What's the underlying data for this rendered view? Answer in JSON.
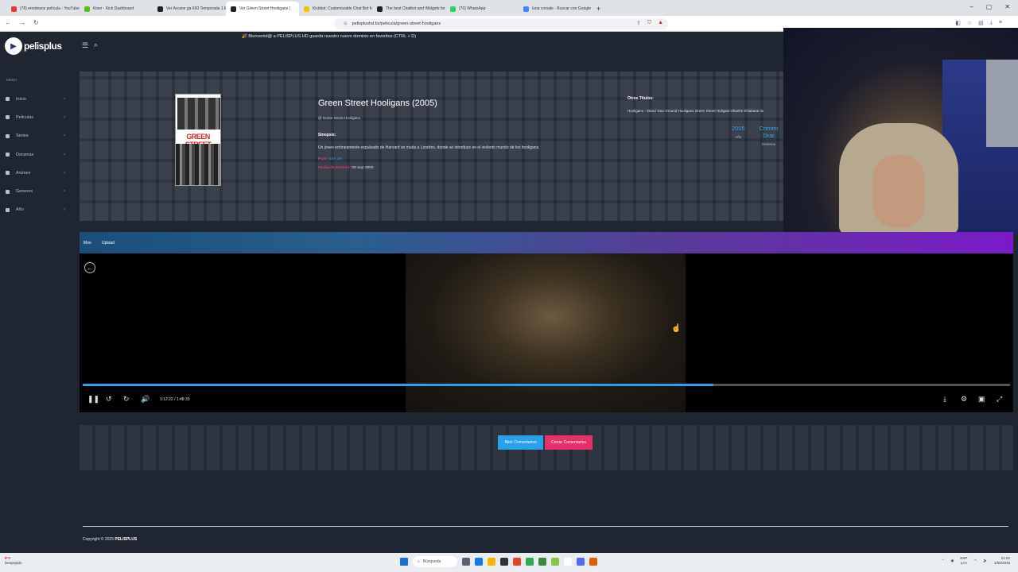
{
  "browser": {
    "tabs": [
      {
        "title": "(78) emoteans película - YouTube",
        "color": "#e53935"
      },
      {
        "title": "Kixer - Kick Dashboard",
        "color": "#53c11c"
      },
      {
        "title": "Ver Arcane ga 600 Temporada 1 Epis",
        "color": "#222"
      },
      {
        "title": "Ver Green Street Hooligans (",
        "color": "#222",
        "active": true
      },
      {
        "title": "Kickbot: Customizable Chat Bot for",
        "color": "#f2c200"
      },
      {
        "title": "The best Chatbot and Widgets for K",
        "color": "#222"
      },
      {
        "title": "(70) WhatsApp",
        "color": "#25d366"
      },
      {
        "title": "luna corsale - Buscar con Google",
        "color": "#4285f4"
      }
    ],
    "new_tab": "+",
    "window_controls": [
      "–",
      "▢",
      "✕"
    ],
    "url": "pelisplushd.bz/pelicula/green-street-hooligans"
  },
  "header": {
    "logo_text": "pelisplus",
    "banner": "🎉 Bienvenid@ a PELISPLUS HD guarda nuestro nuevo dominio en favoritos (CTRL + D)"
  },
  "sidebar": {
    "menu_label": "MENU",
    "items": [
      {
        "label": "Inicio"
      },
      {
        "label": "Peliculas"
      },
      {
        "label": "Series"
      },
      {
        "label": "Doramas"
      },
      {
        "label": "Animes"
      },
      {
        "label": "Generos"
      },
      {
        "label": "Año"
      }
    ]
  },
  "movie": {
    "poster_title": "GREEN STREET",
    "title": "Green Street Hooligans (2005)",
    "original_title": "@ Green Street Hooligans",
    "synopsis_label": "Sinopsis:",
    "synopsis": "Un joven erróneamente expulsado de Harvard se muda a Londres, donde se introduce en el violento mundo de los hooligans.",
    "country_label": "País:",
    "country": "USA UK",
    "release_label": "Fecha de estreno:",
    "release_date": "09 Sep 2005",
    "other_titles_label": "Otros Títulos:",
    "other_titles": "Hooligans - Stand Your Ground Hooligans Green Street Huligani Obashe Khiabane Gr",
    "year_value": "2005",
    "year_label": "Año",
    "genres_value": "Crimen Drar",
    "genres_label": "Generos"
  },
  "player": {
    "tabs": [
      "Moe",
      "Upload"
    ],
    "time": "1:12:22 / 1:48:33",
    "progress": 0.6805,
    "accent": "#2aa0e8"
  },
  "comments": {
    "open_label": "Abrir Comentarios",
    "close_label": "Cerrar Comentarios"
  },
  "footer": {
    "copyright_prefix": "Copyright © 2025",
    "site": "PELISPLUS"
  },
  "taskbar": {
    "weather_temp": "8°C",
    "weather_desc": "Despejado",
    "search_placeholder": "Búsqueda",
    "lang": "ESP",
    "lang_sub": "LAA",
    "clock_time": "21:22",
    "clock_date": "1/06/2025"
  }
}
